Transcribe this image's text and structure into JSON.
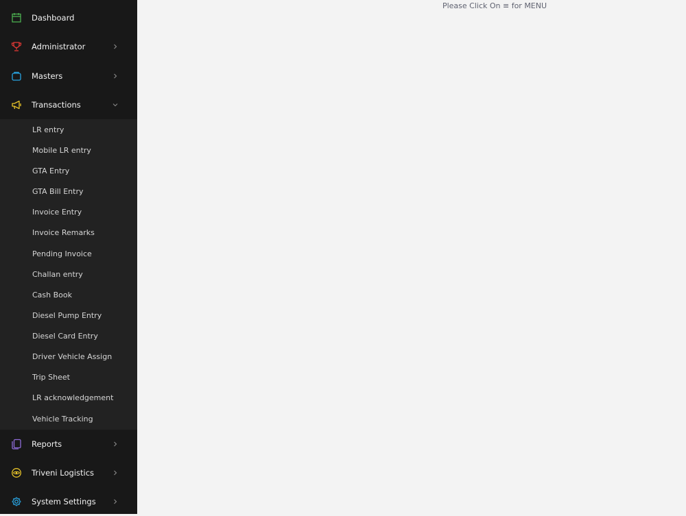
{
  "sidebar": {
    "items": [
      {
        "label": "Dashboard",
        "icon": "calendar-icon",
        "color": "#4caf50",
        "has_chevron": false
      },
      {
        "label": "Administrator",
        "icon": "trophy-icon",
        "color": "#e53935",
        "has_chevron": true
      },
      {
        "label": "Masters",
        "icon": "box-icon",
        "color": "#29a3e0",
        "has_chevron": true
      },
      {
        "label": "Transactions",
        "icon": "megaphone-icon",
        "color": "#e6c229",
        "has_chevron": true,
        "expanded": true
      },
      {
        "label": "Reports",
        "icon": "copy-icon",
        "color": "#8e6bd8",
        "has_chevron": true
      },
      {
        "label": "Triveni Logistics",
        "icon": "eye-circle-icon",
        "color": "#e6c229",
        "has_chevron": true
      },
      {
        "label": "System Settings",
        "icon": "gear-icon",
        "color": "#29a3e0",
        "has_chevron": true
      }
    ],
    "transactions_submenu": [
      "LR entry",
      "Mobile LR entry",
      "GTA Entry",
      "GTA Bill Entry",
      "Invoice Entry",
      "Invoice Remarks",
      "Pending Invoice",
      "Challan entry",
      "Cash Book",
      "Diesel Pump Entry",
      "Diesel Card Entry",
      "Driver Vehicle Assign",
      "Trip Sheet",
      "LR acknowledgement",
      "Vehicle Tracking"
    ]
  },
  "main": {
    "hint": "Please Click On ≡ for MENU"
  }
}
